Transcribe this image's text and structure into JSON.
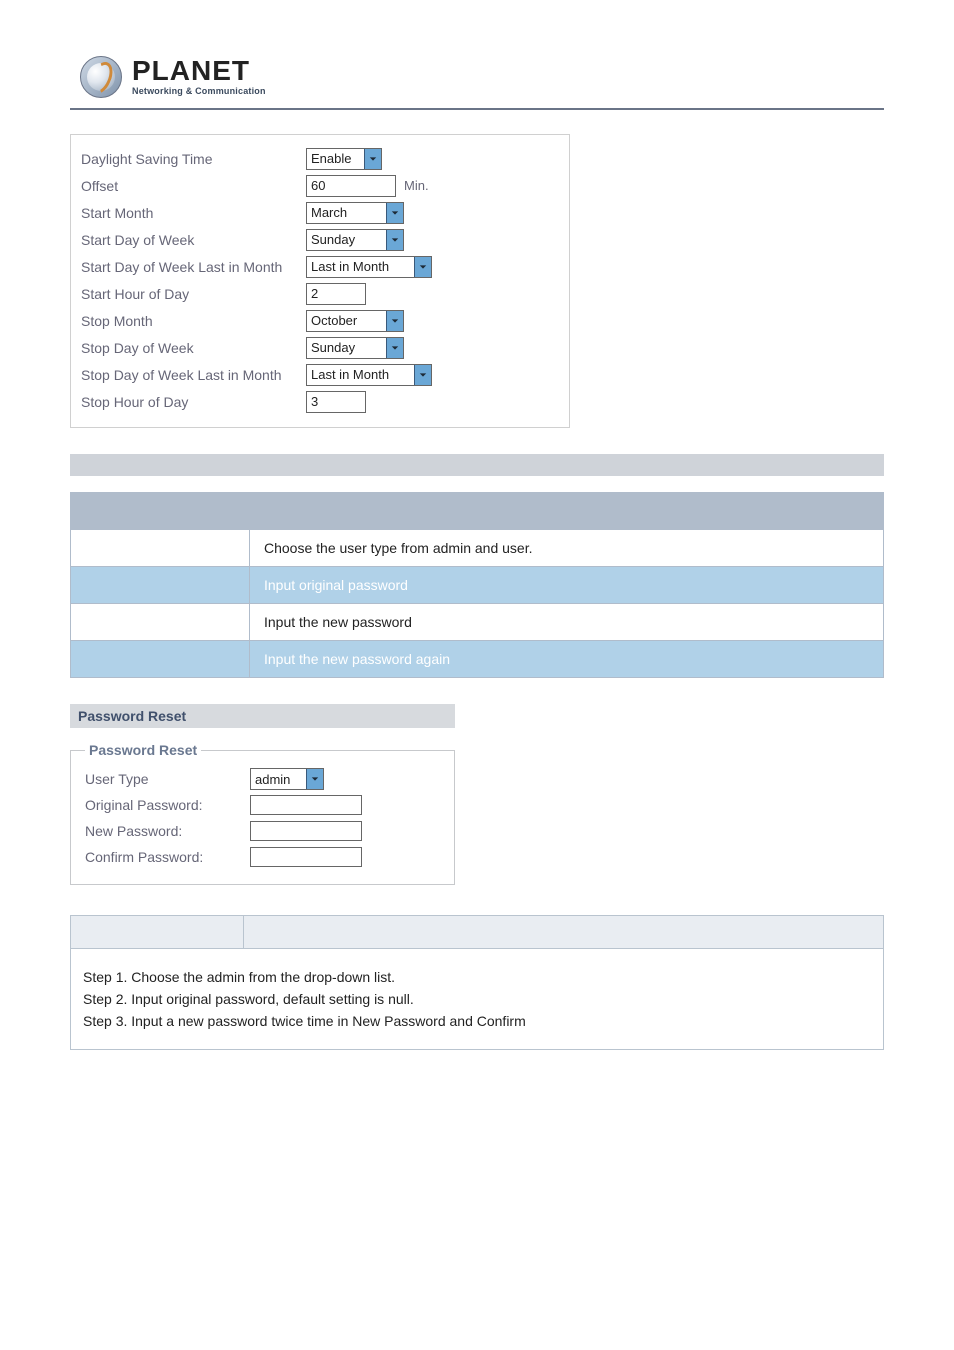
{
  "brand": {
    "name": "PLANET",
    "tagline": "Networking & Communication"
  },
  "dst": {
    "enable": {
      "label": "Daylight Saving Time",
      "value": "Enable"
    },
    "offset": {
      "label": "Offset",
      "value": "60",
      "unit": "Min."
    },
    "start_month": {
      "label": "Start Month",
      "value": "March"
    },
    "start_dow": {
      "label": "Start Day of Week",
      "value": "Sunday"
    },
    "start_dow_last": {
      "label": "Start Day of Week Last in Month",
      "value": "Last in Month"
    },
    "start_hour": {
      "label": "Start Hour of Day",
      "value": "2"
    },
    "stop_month": {
      "label": "Stop Month",
      "value": "October"
    },
    "stop_dow": {
      "label": "Stop Day of Week",
      "value": "Sunday"
    },
    "stop_dow_last": {
      "label": "Stop Day of Week Last in Month",
      "value": "Last in Month"
    },
    "stop_hour": {
      "label": "Stop Hour of Day",
      "value": "3"
    }
  },
  "desc_rows": [
    "Choose the user type from admin and user.",
    "Input original password",
    "Input the new password",
    "Input the new password again"
  ],
  "pw": {
    "section_title": "Password Reset",
    "legend": "Password Reset",
    "user_type": {
      "label": "User Type",
      "value": "admin"
    },
    "original": {
      "label": "Original Password:"
    },
    "new": {
      "label": "New Password:"
    },
    "confirm": {
      "label": "Confirm Password:"
    }
  },
  "steps": [
    "Step 1. Choose the admin from the drop-down list.",
    "Step 2. Input original password, default setting is null.",
    "Step 3. Input a new password twice time in New Password and Confirm"
  ]
}
